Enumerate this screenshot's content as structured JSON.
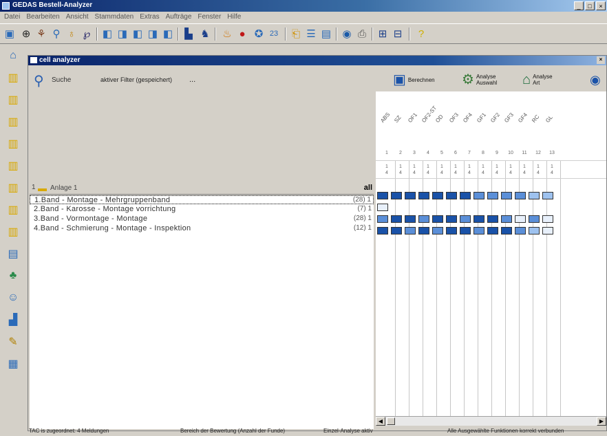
{
  "window": {
    "title": "GEDAS Bestell-Analyzer"
  },
  "menu": [
    "Datei",
    "Bearbeiten",
    "Ansicht",
    "Stammdaten",
    "Extras",
    "Aufträge",
    "Fenster",
    "Hilfe"
  ],
  "child": {
    "title": "cell analyzer"
  },
  "filter": {
    "search_label": "Suche",
    "filter_label": "aktiver Filter (gespeichert)",
    "dots": "..."
  },
  "buttons": [
    {
      "label1": "Berechnen",
      "label2": ""
    },
    {
      "label1": "Analyse",
      "label2": "Auswahl"
    },
    {
      "label1": "Analyse",
      "label2": "Art"
    }
  ],
  "tree": {
    "header_num": "1",
    "header_label": "Anlage 1",
    "count_label": "all",
    "rows": [
      {
        "text": "1.Band - Montage - Mehrgruppenband",
        "count": "(28) 1"
      },
      {
        "text": "2.Band - Karosse - Montage vorrichtung",
        "count": "(7) 1"
      },
      {
        "text": "3.Band - Vormontage - Montage",
        "count": "(28) 1"
      },
      {
        "text": "4.Band - Schmierung - Montage - Inspektion",
        "count": "(12) 1"
      }
    ]
  },
  "grid": {
    "columns": [
      "ABS",
      "SZ",
      "OF1",
      "OF2-ST",
      "OD",
      "OF3",
      "OF4",
      "GF1",
      "GF2",
      "GF3",
      "GF4",
      "RC",
      "GL"
    ],
    "numbers": [
      "1",
      "2",
      "3",
      "4",
      "5",
      "6",
      "7",
      "8",
      "9",
      "10",
      "11",
      "12",
      "13"
    ],
    "sub1": [
      "1",
      "1",
      "1",
      "1",
      "1",
      "1",
      "1",
      "1",
      "1",
      "1",
      "1",
      "1",
      "1"
    ],
    "sub2": [
      "4",
      "4",
      "4",
      "4",
      "4",
      "4",
      "4",
      "4",
      "4",
      "4",
      "4",
      "4",
      "4"
    ],
    "cells": [
      [
        "d",
        "d",
        "d",
        "d",
        "d",
        "d",
        "d",
        "m",
        "m",
        "m",
        "m",
        "l",
        "l"
      ],
      [
        "w",
        "",
        "",
        "",
        "",
        "",
        "",
        "",
        "",
        "",
        "",
        "",
        ""
      ],
      [
        "m",
        "d",
        "d",
        "m",
        "d",
        "d",
        "m",
        "d",
        "d",
        "m",
        "w",
        "m",
        "w"
      ],
      [
        "d",
        "d",
        "m",
        "d",
        "m",
        "d",
        "d",
        "m",
        "d",
        "d",
        "m",
        "l",
        "w"
      ]
    ]
  },
  "status": [
    "TAC is zugeordnet: 4 Meldungen",
    "Bereich der Bewertung (Anzahl der Funde)",
    "Einzel-Analyse aktiv",
    "Alle Ausgewählte Funktionen korrekt verbunden"
  ]
}
